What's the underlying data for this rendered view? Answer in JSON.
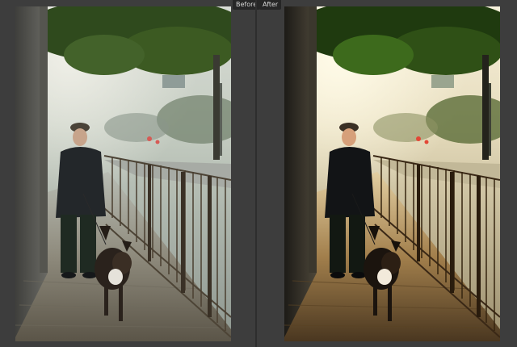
{
  "compare": {
    "before_label": "Before",
    "after_label": "After"
  },
  "colors": {
    "background": "#3d3d3d",
    "label_bg": "#262626",
    "label_text": "#d8d8d8"
  },
  "images": {
    "before": {
      "subject": "photo-before-edit",
      "tone": "flat"
    },
    "after": {
      "subject": "photo-after-edit",
      "tone": "contrast-enhanced"
    }
  }
}
